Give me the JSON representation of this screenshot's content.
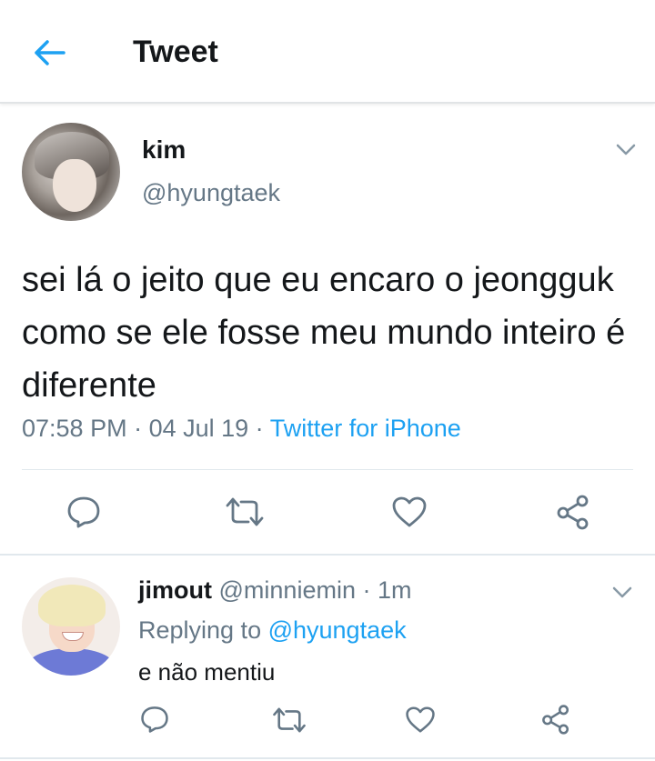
{
  "header": {
    "title": "Tweet",
    "back_icon": "back-arrow-icon"
  },
  "colors": {
    "accent": "#1da1f2",
    "secondary_text": "#657786",
    "primary_text": "#14171a",
    "divider": "#e1e8ed"
  },
  "tweet": {
    "name": "kim",
    "handle": "@hyungtaek",
    "text": "sei lá o jeito que eu encaro o jeongguk como se ele fosse meu mundo inteiro é diferente",
    "time": "07:58 PM",
    "date_sep": " · ",
    "date": "04 Jul 19",
    "source_sep": " · ",
    "source": "Twitter for iPhone",
    "actions": [
      "reply-icon",
      "retweet-icon",
      "like-icon",
      "share-icon"
    ]
  },
  "reply": {
    "name": "jimout",
    "handle": "@minniemin",
    "age_sep": " · ",
    "age": "1m",
    "replying_prefix": "Replying to ",
    "replying_handle": "@hyungtaek",
    "text": "e não mentiu",
    "actions": [
      "reply-icon",
      "retweet-icon",
      "like-icon",
      "share-icon"
    ]
  }
}
